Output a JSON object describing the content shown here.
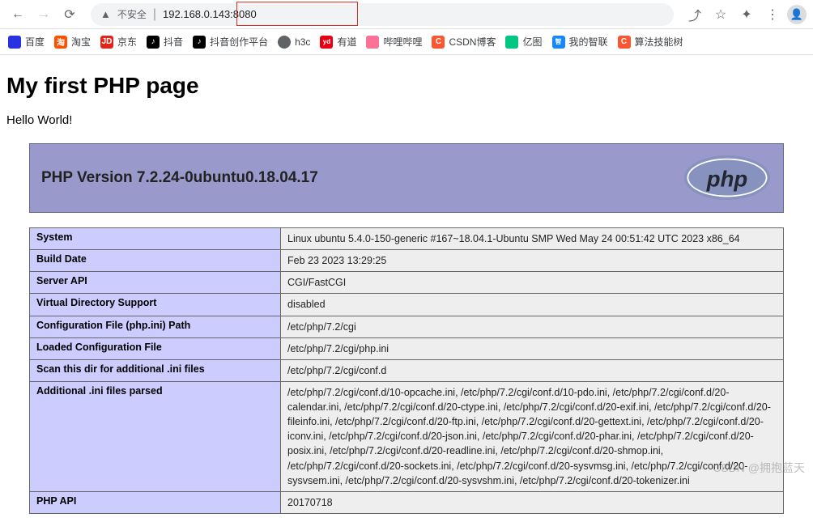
{
  "browser": {
    "insecure_label": "不安全",
    "url": "192.168.0.143:8080"
  },
  "bookmarks": [
    {
      "label": "百度",
      "icon_class": "bm-baidu",
      "icon_text": ""
    },
    {
      "label": "淘宝",
      "icon_class": "bm-taobao",
      "icon_text": "淘"
    },
    {
      "label": "京东",
      "icon_class": "bm-jd",
      "icon_text": "JD"
    },
    {
      "label": "抖音",
      "icon_class": "bm-douyin",
      "icon_text": "♪"
    },
    {
      "label": "抖音创作平台",
      "icon_class": "bm-douyin",
      "icon_text": "♪"
    },
    {
      "label": "h3c",
      "icon_class": "bm-h3c",
      "icon_text": ""
    },
    {
      "label": "有道",
      "icon_class": "bm-youdao",
      "icon_text": "yd"
    },
    {
      "label": "哔哩哔哩",
      "icon_class": "bm-bili",
      "icon_text": ""
    },
    {
      "label": "CSDN博客",
      "icon_class": "bm-csdn",
      "icon_text": "C"
    },
    {
      "label": "亿图",
      "icon_class": "bm-yitu",
      "icon_text": ""
    },
    {
      "label": "我的智联",
      "icon_class": "bm-zhilian",
      "icon_text": "智"
    },
    {
      "label": "算法技能树",
      "icon_class": "bm-suanfa",
      "icon_text": "C"
    }
  ],
  "page": {
    "title": "My first PHP page",
    "hello": "Hello World!",
    "php_version": "PHP Version 7.2.24-0ubuntu0.18.04.17",
    "rows": [
      {
        "k": "System",
        "v": "Linux ubuntu 5.4.0-150-generic #167~18.04.1-Ubuntu SMP Wed May 24 00:51:42 UTC 2023 x86_64"
      },
      {
        "k": "Build Date",
        "v": "Feb 23 2023 13:29:25"
      },
      {
        "k": "Server API",
        "v": "CGI/FastCGI"
      },
      {
        "k": "Virtual Directory Support",
        "v": "disabled"
      },
      {
        "k": "Configuration File (php.ini) Path",
        "v": "/etc/php/7.2/cgi"
      },
      {
        "k": "Loaded Configuration File",
        "v": "/etc/php/7.2/cgi/php.ini"
      },
      {
        "k": "Scan this dir for additional .ini files",
        "v": "/etc/php/7.2/cgi/conf.d"
      },
      {
        "k": "Additional .ini files parsed",
        "v": "/etc/php/7.2/cgi/conf.d/10-opcache.ini, /etc/php/7.2/cgi/conf.d/10-pdo.ini, /etc/php/7.2/cgi/conf.d/20-calendar.ini, /etc/php/7.2/cgi/conf.d/20-ctype.ini, /etc/php/7.2/cgi/conf.d/20-exif.ini, /etc/php/7.2/cgi/conf.d/20-fileinfo.ini, /etc/php/7.2/cgi/conf.d/20-ftp.ini, /etc/php/7.2/cgi/conf.d/20-gettext.ini, /etc/php/7.2/cgi/conf.d/20-iconv.ini, /etc/php/7.2/cgi/conf.d/20-json.ini, /etc/php/7.2/cgi/conf.d/20-phar.ini, /etc/php/7.2/cgi/conf.d/20-posix.ini, /etc/php/7.2/cgi/conf.d/20-readline.ini, /etc/php/7.2/cgi/conf.d/20-shmop.ini, /etc/php/7.2/cgi/conf.d/20-sockets.ini, /etc/php/7.2/cgi/conf.d/20-sysvmsg.ini, /etc/php/7.2/cgi/conf.d/20-sysvsem.ini, /etc/php/7.2/cgi/conf.d/20-sysvshm.ini, /etc/php/7.2/cgi/conf.d/20-tokenizer.ini"
      },
      {
        "k": "PHP API",
        "v": "20170718"
      }
    ]
  },
  "watermark": "CSDN @拥抱蓝天"
}
